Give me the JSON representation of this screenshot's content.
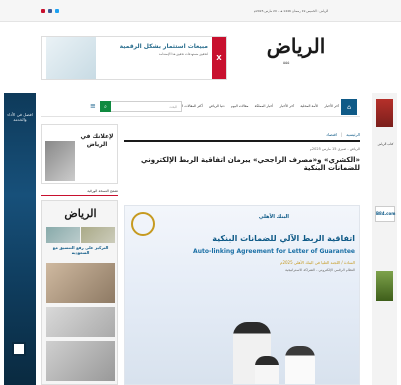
{
  "topbar": {
    "date": "الرياض : الخميس 19 رمضان 1446 هـ - 20 مارس 2025م"
  },
  "ad_top": {
    "badge": "X",
    "line1": "مبيعات استثمار بشكل الرقمية",
    "line2": "لتحقيق مستهدفات تحقيق هذا الإستدامة"
  },
  "site": {
    "logo": "الرياض",
    "logo_sub": "٥٥٥"
  },
  "nav": {
    "items": [
      "آخر الأخبار",
      "الأمة المحلية",
      "آخر الأخبار",
      "أخبار المملكة",
      "مقالات اليوم",
      "دنيا الرياض",
      "أكثر المقالات الوطنية"
    ],
    "search_placeholder": "البحث"
  },
  "sidebar": {
    "ad_heading": "لإعلانك في الرياض",
    "ad_sub": "الخيار الأفضل",
    "edition_label": "تصفح النسخة الورقية",
    "edition_masthead": "الرياض",
    "edition_headline": "التركيز على رفع التنسيق مع السعودية"
  },
  "left_banner": {
    "text": "افضل في الأداء والخدمة"
  },
  "right_banner": {
    "text": "كتاب الرياض",
    "box": "B84.com"
  },
  "article": {
    "breadcrumb": [
      "الرئيسية",
      "اقتصاد"
    ],
    "meta": "الرياض - صبري 15 مارس 2025م",
    "headline": "«الكشري» و«مصرف الراجحي» يبرمان اتفاقية الربط الإلكتروني للضمانات البنكية",
    "hero": {
      "brand": "البنك الأهلي",
      "title_ar": "اتفاقية الربط الآلي للضمانات البنكية",
      "title_en": "Auto-linking Agreement for Letter of Guarantee",
      "subtitle": "السادة / اللجنة العليا في البنك الأهلي 2025م",
      "footnote": "النظام الرقمي الإلكتروني - الشراكة الاستراتيجية"
    }
  }
}
